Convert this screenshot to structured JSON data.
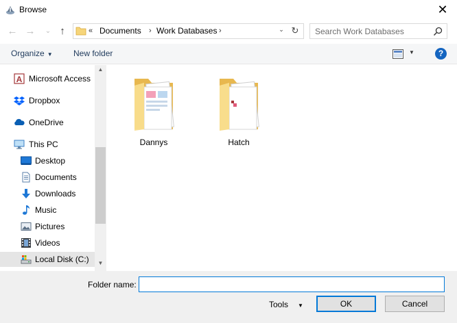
{
  "window": {
    "title": "Browse",
    "close_glyph": "✕"
  },
  "nav": {
    "back_glyph": "←",
    "forward_glyph": "→",
    "recent_glyph": "⌄",
    "up_glyph": "↑"
  },
  "address": {
    "prefix": "«",
    "crumbs": [
      "Documents",
      "Work Databases"
    ],
    "separator": "›",
    "dropdown_glyph": "⌄",
    "refresh_glyph": "↻"
  },
  "search": {
    "placeholder": "Search Work Databases"
  },
  "toolbar": {
    "organize_label": "Organize",
    "new_folder_label": "New folder",
    "help_label": "?"
  },
  "sidebar": {
    "items": [
      {
        "label": "Microsoft Access",
        "icon": "access-icon"
      },
      {
        "label": "Dropbox",
        "icon": "dropbox-icon"
      },
      {
        "label": "OneDrive",
        "icon": "onedrive-icon"
      },
      {
        "label": "This PC",
        "icon": "pc-icon"
      },
      {
        "label": "Desktop",
        "icon": "desktop-icon"
      },
      {
        "label": "Documents",
        "icon": "documents-icon"
      },
      {
        "label": "Downloads",
        "icon": "downloads-icon"
      },
      {
        "label": "Music",
        "icon": "music-icon"
      },
      {
        "label": "Pictures",
        "icon": "pictures-icon"
      },
      {
        "label": "Videos",
        "icon": "videos-icon"
      },
      {
        "label": "Local Disk (C:)",
        "icon": "disk-icon",
        "selected": true
      }
    ]
  },
  "folders": [
    {
      "name": "Dannys"
    },
    {
      "name": "Hatch"
    }
  ],
  "footer": {
    "folder_name_label": "Folder name:",
    "folder_name_value": "",
    "tools_label": "Tools",
    "ok_label": "OK",
    "cancel_label": "Cancel"
  },
  "colors": {
    "accent": "#0078d7",
    "folder": "#f6d57a",
    "selected_bg": "#e5e5e5"
  }
}
